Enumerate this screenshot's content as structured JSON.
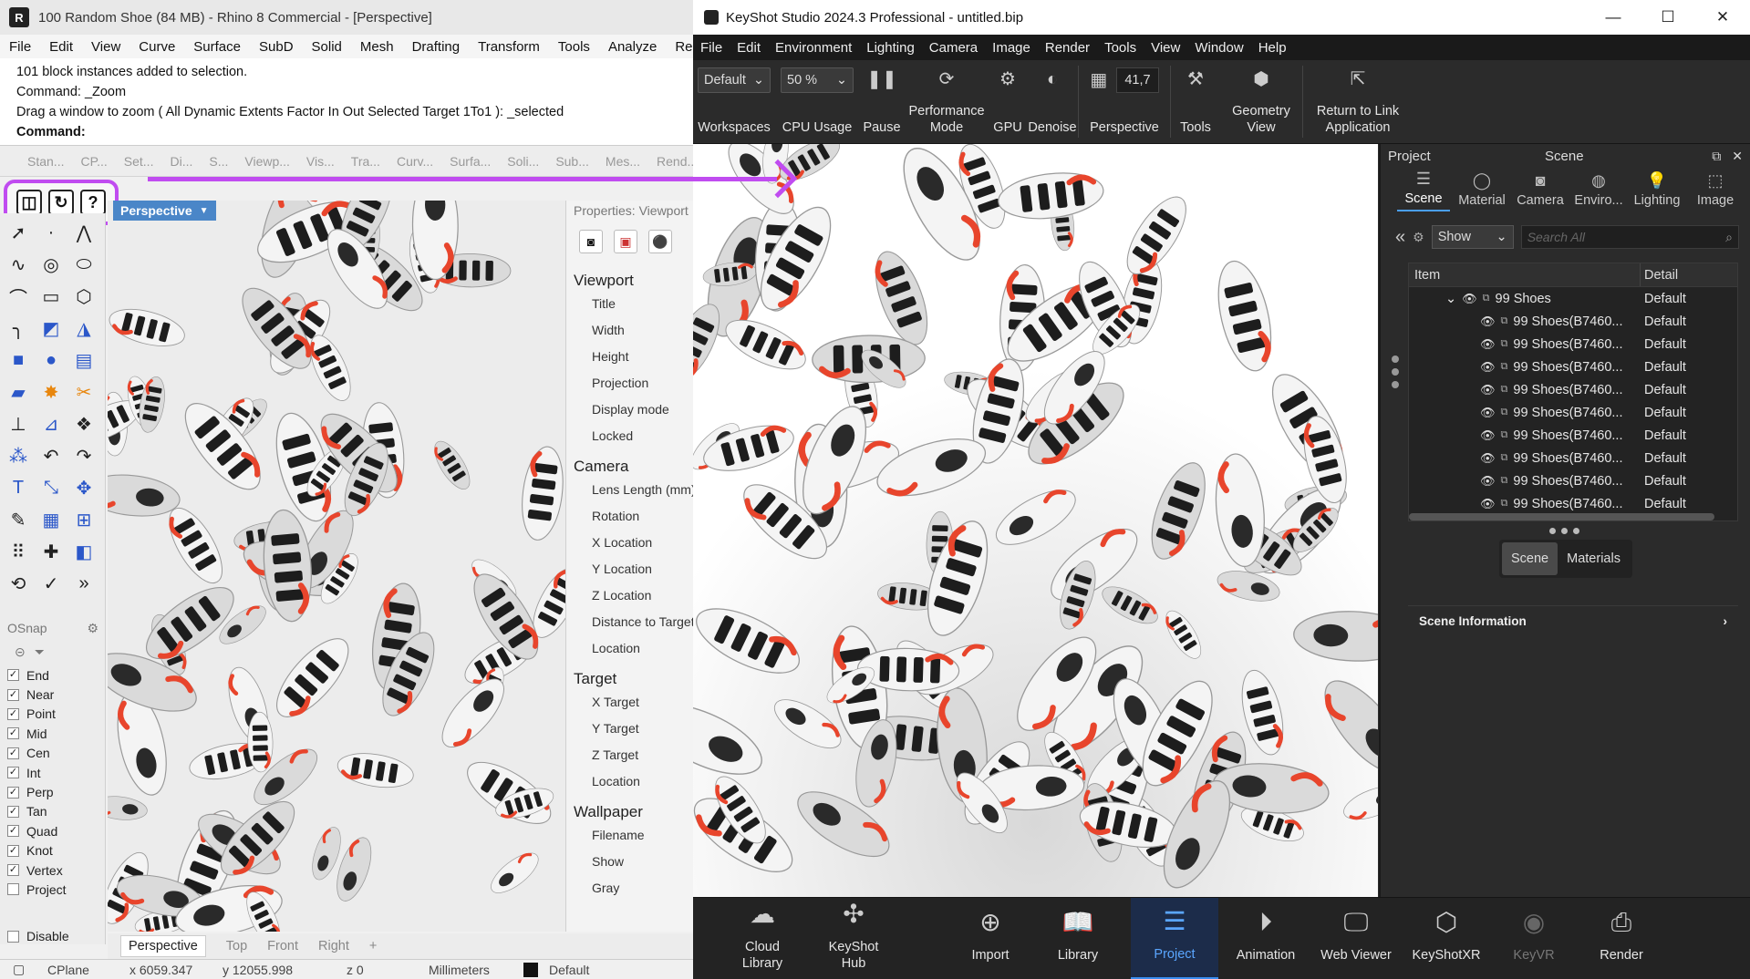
{
  "rhino": {
    "title": "100 Random Shoe (84 MB) - Rhino 8 Commercial - [Perspective]",
    "menu": [
      "File",
      "Edit",
      "View",
      "Curve",
      "Surface",
      "SubD",
      "Solid",
      "Mesh",
      "Drafting",
      "Transform",
      "Tools",
      "Analyze",
      "Render"
    ],
    "command_lines": [
      "101 block instances added to selection.",
      "Command: _Zoom",
      "Drag a window to zoom ( All  Dynamic  Extents  Factor  In  Out  Selected  Target  1To1 ): _selected"
    ],
    "command_prompt": "Command:",
    "toolbar_tabs": [
      "Stan...",
      "CP...",
      "Set...",
      "Di...",
      "S...",
      "Viewp...",
      "Vis...",
      "Tra...",
      "Curv...",
      "Surfa...",
      "Soli...",
      "Sub...",
      "Mes...",
      "Rend..."
    ],
    "highlight_buttons": [
      "camera-sync-icon",
      "refresh-icon",
      "help-icon"
    ],
    "highlight_color": "#c04cf0",
    "viewport_label": "Perspective",
    "properties_header": "Properties: Viewport",
    "properties": {
      "viewport_section": "Viewport",
      "viewport_rows": [
        "Title",
        "Width",
        "Height",
        "Projection",
        "Display mode",
        "Locked"
      ],
      "camera_section": "Camera",
      "camera_rows": [
        "Lens Length (mm)",
        "Rotation",
        "X Location",
        "Y Location",
        "Z Location",
        "Distance to Target",
        "Location"
      ],
      "target_section": "Target",
      "target_rows": [
        "X Target",
        "Y Target",
        "Z Target",
        "Location"
      ],
      "wallpaper_section": "Wallpaper",
      "wallpaper_rows": [
        "Filename",
        "Show",
        "Gray"
      ]
    },
    "osnap": {
      "title": "OSnap",
      "items": [
        {
          "label": "End",
          "checked": true
        },
        {
          "label": "Near",
          "checked": true
        },
        {
          "label": "Point",
          "checked": true
        },
        {
          "label": "Mid",
          "checked": true
        },
        {
          "label": "Cen",
          "checked": true
        },
        {
          "label": "Int",
          "checked": true
        },
        {
          "label": "Perp",
          "checked": true
        },
        {
          "label": "Tan",
          "checked": true
        },
        {
          "label": "Quad",
          "checked": true
        },
        {
          "label": "Knot",
          "checked": true
        },
        {
          "label": "Vertex",
          "checked": true
        },
        {
          "label": "Project",
          "checked": false
        }
      ],
      "disable_label": "Disable"
    },
    "view_tabs": [
      "Perspective",
      "Top",
      "Front",
      "Right",
      "+"
    ],
    "status": {
      "cplane": "CPlane",
      "x": "x 6059.347",
      "y": "y 12055.998",
      "z": "z 0",
      "units": "Millimeters",
      "layer": "Default"
    }
  },
  "keyshot": {
    "title": "KeyShot Studio 2024.3 Professional  - untitled.bip",
    "window_controls": [
      "—",
      "☐",
      "✕"
    ],
    "menu": [
      "File",
      "Edit",
      "Environment",
      "Lighting",
      "Camera",
      "Image",
      "Render",
      "Tools",
      "View",
      "Window",
      "Help"
    ],
    "toolbar": {
      "workspace_value": "Default",
      "workspace_label": "Workspaces",
      "cpu_value": "50 %",
      "cpu_label": "CPU Usage",
      "pause_label": "Pause",
      "performance_label": "Performance Mode",
      "gpu_label": "GPU",
      "denoise_label": "Denoise",
      "camera_value": "41,7",
      "camera_label": "Perspective",
      "tools_label": "Tools",
      "geometry_label": "Geometry View",
      "return_label": "Return to Link Application"
    },
    "panel": {
      "left_title": "Project",
      "center_title": "Scene",
      "tabs": [
        {
          "label": "Scene",
          "icon": "list-icon",
          "active": true
        },
        {
          "label": "Material",
          "icon": "sphere-icon",
          "active": false
        },
        {
          "label": "Camera",
          "icon": "camera-icon",
          "active": false
        },
        {
          "label": "Enviro...",
          "icon": "globe-icon",
          "active": false
        },
        {
          "label": "Lighting",
          "icon": "bulb-icon",
          "active": false
        },
        {
          "label": "Image",
          "icon": "frame-icon",
          "active": false
        }
      ],
      "show_value": "Show",
      "search_placeholder": "Search All",
      "tree_headers": [
        "Item",
        "Detail"
      ],
      "tree_root": {
        "name": "99 Shoes",
        "detail": "Default"
      },
      "tree_items": [
        {
          "name": "99 Shoes(B7460...",
          "detail": "Default"
        },
        {
          "name": "99 Shoes(B7460...",
          "detail": "Default"
        },
        {
          "name": "99 Shoes(B7460...",
          "detail": "Default"
        },
        {
          "name": "99 Shoes(B7460...",
          "detail": "Default"
        },
        {
          "name": "99 Shoes(B7460...",
          "detail": "Default"
        },
        {
          "name": "99 Shoes(B7460...",
          "detail": "Default"
        },
        {
          "name": "99 Shoes(B7460...",
          "detail": "Default"
        },
        {
          "name": "99 Shoes(B7460...",
          "detail": "Default"
        },
        {
          "name": "99 Shoes(B7460...",
          "detail": "Default"
        }
      ],
      "segment": [
        "Scene",
        "Materials"
      ],
      "scene_info": "Scene Information"
    },
    "bottom": [
      {
        "label": "Cloud Library",
        "icon": "cloud-icon"
      },
      {
        "label": "KeyShot Hub",
        "icon": "hub-icon"
      },
      {
        "label": "Import",
        "icon": "import-icon"
      },
      {
        "label": "Library",
        "icon": "book-icon"
      },
      {
        "label": "Project",
        "icon": "project-icon"
      },
      {
        "label": "Animation",
        "icon": "play-icon"
      },
      {
        "label": "Web Viewer",
        "icon": "monitor-icon"
      },
      {
        "label": "KeyShotXR",
        "icon": "cube-icon"
      },
      {
        "label": "KeyVR",
        "icon": "vr-icon"
      },
      {
        "label": "Render",
        "icon": "render-icon"
      }
    ],
    "accent": "#3a8df0"
  }
}
